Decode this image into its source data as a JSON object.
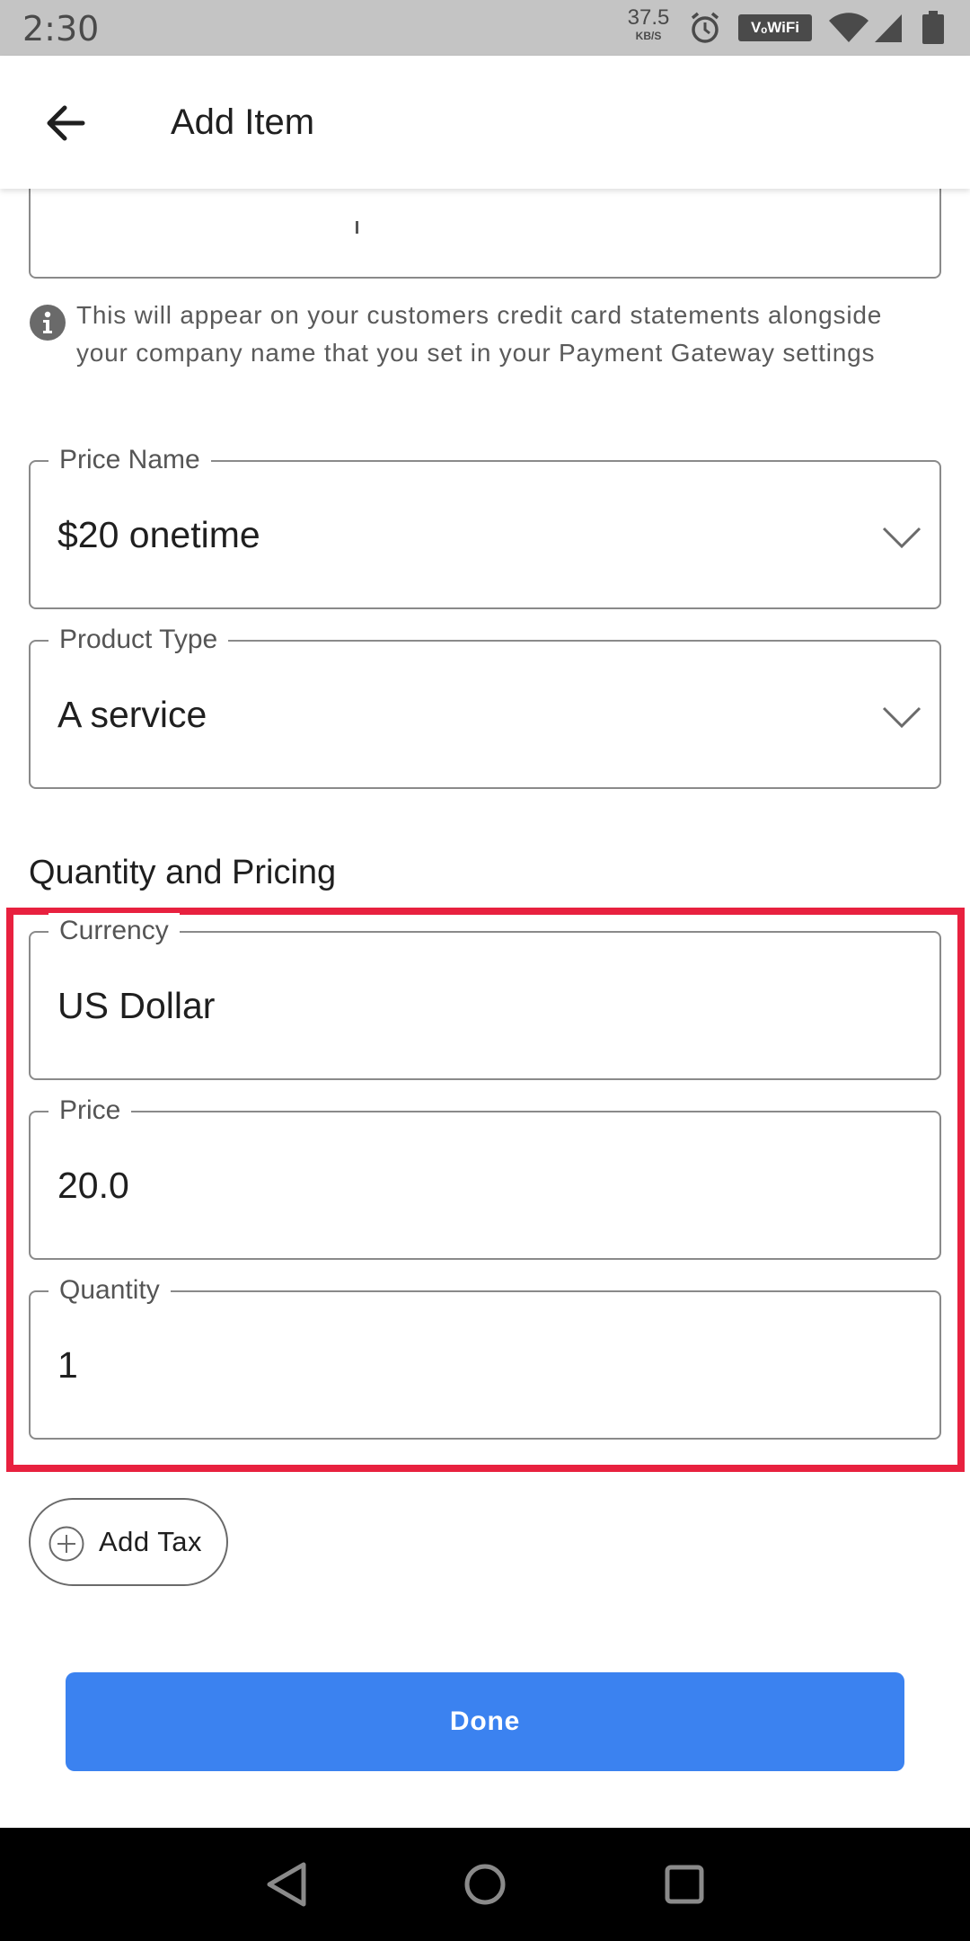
{
  "status_bar": {
    "time": "2:30",
    "net_speed": "37.5",
    "net_speed_unit": "KB/S",
    "wifi_badge": "VₒWiFi",
    "background": "#c4c4c4",
    "icons": [
      "alarm-icon",
      "wifi-signal-icon",
      "cell-signal-icon",
      "battery-icon"
    ]
  },
  "app_bar": {
    "title": "Add Item",
    "back_icon": "back-arrow-icon"
  },
  "info": {
    "icon": "info-icon",
    "text": "This will appear on your customers credit card statements alongside your company name that you set in your Payment Gateway settings"
  },
  "fields": {
    "price_name": {
      "label": "Price Name",
      "value": "$20 onetime"
    },
    "product_type": {
      "label": "Product Type",
      "value": "A service"
    },
    "currency": {
      "label": "Currency",
      "value": "US Dollar"
    },
    "price": {
      "label": "Price",
      "value": "20.0"
    },
    "quantity": {
      "label": "Quantity",
      "value": "1"
    }
  },
  "section": {
    "quantity_pricing": "Quantity and Pricing"
  },
  "actions": {
    "add_tax": "Add Tax",
    "done": "Done"
  },
  "colors": {
    "accent": "#3b82f0",
    "highlight": "#e8213f",
    "border": "#8a8a8a"
  },
  "nav_bar": {
    "icons": [
      "back-triangle-icon",
      "home-circle-icon",
      "recents-square-icon"
    ]
  }
}
